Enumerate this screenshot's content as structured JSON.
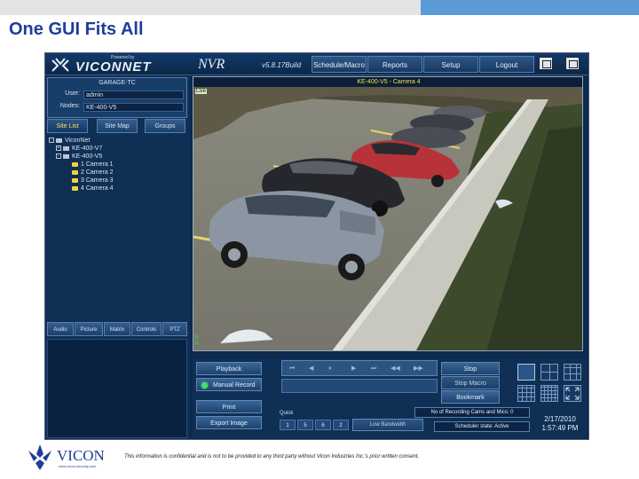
{
  "slide": {
    "title": "One GUI Fits All",
    "footer_logo_text": "VICON",
    "footer_logo_sub": "www.vicon-security.com",
    "confidential": "This information is confidential and is not to be provided to any third party without Vicon Industries Inc.'s prior written consent."
  },
  "header": {
    "powered_by": "Powered by",
    "logo": "VICONNET",
    "app_name": "NVR",
    "version": "v5.8.17Build",
    "buttons": [
      "Schedule/Macro",
      "Reports",
      "Setup",
      "Logout"
    ]
  },
  "left": {
    "server_name": "GARAGE-TC",
    "user_label": "User:",
    "user_value": "admin",
    "nodes_label": "Nodes:",
    "nodes_value": "KE-400-V5",
    "tabs": [
      "Site List",
      "Site Map",
      "Groups"
    ],
    "active_tab": "Site List",
    "tree": {
      "root": "ViconNet",
      "servers": [
        "KE-400-V7",
        "KE-400-V5"
      ],
      "cameras": [
        "1 Camera 1",
        "2 Camera 2",
        "3 Camera 3",
        "4 Camera 4"
      ]
    },
    "bottom_tabs": [
      "Audio",
      "Picture",
      "Matrix",
      "Controls",
      "PTZ"
    ]
  },
  "video": {
    "camera_label": "KE-400-V5 - Camera 4",
    "live_tag": "Live",
    "corner_tag_1": "P",
    "corner_tag_2": "R"
  },
  "controls": {
    "playback": "Playback",
    "manual_record": "Manual Record",
    "print": "Print",
    "export_image": "Export Image",
    "stop": "Stop",
    "stop_macro": "Stop Macro",
    "bookmark": "Bookmark",
    "quick_label": "Quick",
    "quick_values": [
      "1",
      "5",
      "6",
      "2"
    ],
    "low_bandwidth": "Low Bandwidth",
    "recording_status": "No of Recording Cams and Mics: 0",
    "scheduler_state": "Scheduler state: Active",
    "date": "2/17/2010",
    "time": "1:57:49 PM",
    "transport_icons": [
      "⏮",
      "◀",
      "⏸",
      "▶",
      "⏭",
      "◀◀",
      "▶▶"
    ]
  },
  "colors": {
    "slide_title": "#1f3d99",
    "panel_bg": "#0f2f55",
    "active_tab_text": "#ffe14a",
    "camera_label": "#f3e23a",
    "led_green": "#3ce65b"
  }
}
